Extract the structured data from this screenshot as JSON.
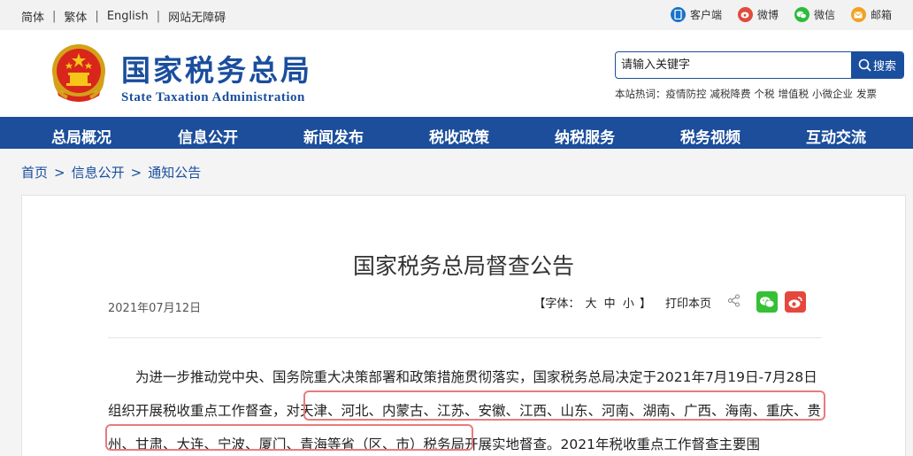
{
  "topbar": {
    "lang": [
      "简体",
      "繁体",
      "English",
      "网站无障碍"
    ],
    "separator": "|",
    "social": [
      {
        "label": "客户端",
        "icon": "mobile-client-icon",
        "color": "#1a73c9"
      },
      {
        "label": "微博",
        "icon": "weibo-icon",
        "color": "#e24a3b"
      },
      {
        "label": "微信",
        "icon": "wechat-icon",
        "color": "#2dbb3b"
      },
      {
        "label": "邮箱",
        "icon": "mail-icon",
        "color": "#f2a126"
      }
    ]
  },
  "header": {
    "logo_cn": "国家税务总局",
    "logo_en": "State Taxation Administration",
    "search_placeholder": "请输入关键字",
    "search_button": "搜索",
    "hot_label": "本站热词：",
    "hot_words": [
      "疫情防控",
      "减税降费",
      "个税",
      "增值税",
      "小微企业",
      "发票"
    ]
  },
  "nav": [
    "总局概况",
    "信息公开",
    "新闻发布",
    "税收政策",
    "纳税服务",
    "税务视频",
    "互动交流"
  ],
  "breadcrumb": [
    "首页",
    "信息公开",
    "通知公告"
  ],
  "breadcrumb_sep": ">",
  "article": {
    "title": "国家税务总局督查公告",
    "date": "2021年07月12日",
    "font_label_open": "【字体：",
    "font_sizes": [
      "大",
      "中",
      "小"
    ],
    "font_label_close": "】",
    "print": "打印本页",
    "body_part1": "为进一步推动党中央、国务院重大决策部署和政策措施贯彻落实，国家税务总局决定于2021年7月19日-7月28日组织开展税收重点工作督查，",
    "body_highlight": "对天津、河北、内蒙古、江苏、安徽、江西、山东、河南、湖南、广西、海南、重庆、贵州、甘肃、大连、宁波、厦门、青海等省（区、市）",
    "body_part2": "税务局开展实地督查。2021年税收重点工作督查主要围"
  },
  "colors": {
    "brand": "#1a4e9e",
    "nav_bg": "#1c4e9b",
    "highlight_border": "#e87c7c"
  }
}
